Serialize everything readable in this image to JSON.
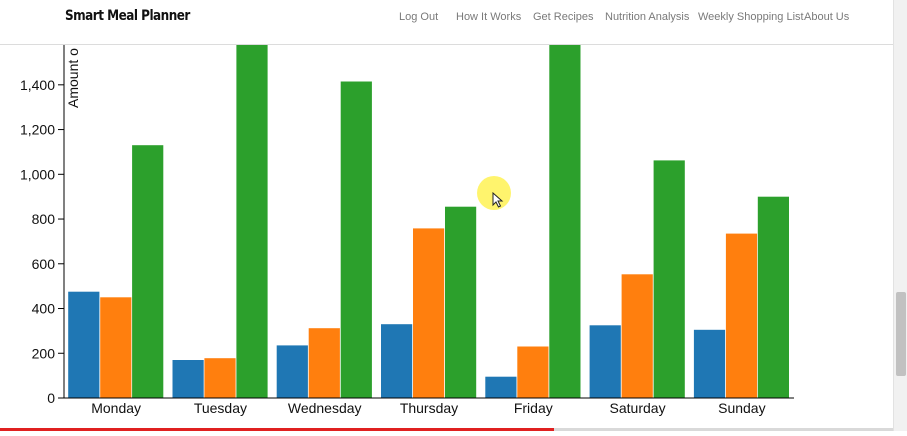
{
  "app": {
    "brand": "Smart Meal Planner"
  },
  "nav": {
    "items": [
      {
        "label": "Log Out"
      },
      {
        "label": "How It Works"
      },
      {
        "label": "Get Recipes"
      },
      {
        "label": "Nutrition Analysis"
      },
      {
        "label": "Weekly Shopping List"
      },
      {
        "label": "About Us"
      }
    ]
  },
  "video_progress": 0.62,
  "chart_data": {
    "type": "bar",
    "ylabel": "Amount o",
    "categories": [
      "Monday",
      "Tuesday",
      "Wednesday",
      "Thursday",
      "Friday",
      "Saturday",
      "Sunday"
    ],
    "series": [
      {
        "color": "#1f77b4",
        "values": [
          475,
          170,
          235,
          330,
          95,
          325,
          305
        ]
      },
      {
        "color": "#ff7f0e",
        "values": [
          450,
          178,
          312,
          758,
          230,
          553,
          735
        ]
      },
      {
        "color": "#2ca02c",
        "values": [
          1130,
          1590,
          1415,
          855,
          1590,
          1062,
          900
        ]
      }
    ],
    "yticks": [
      0,
      200,
      400,
      600,
      800,
      1000,
      1200,
      1400
    ],
    "ytick_labels": [
      "0",
      "200",
      "400",
      "600",
      "800",
      "1,000",
      "1,200",
      "1,400"
    ],
    "ylim": [
      0,
      1590
    ],
    "grid": false,
    "legend": "none"
  }
}
